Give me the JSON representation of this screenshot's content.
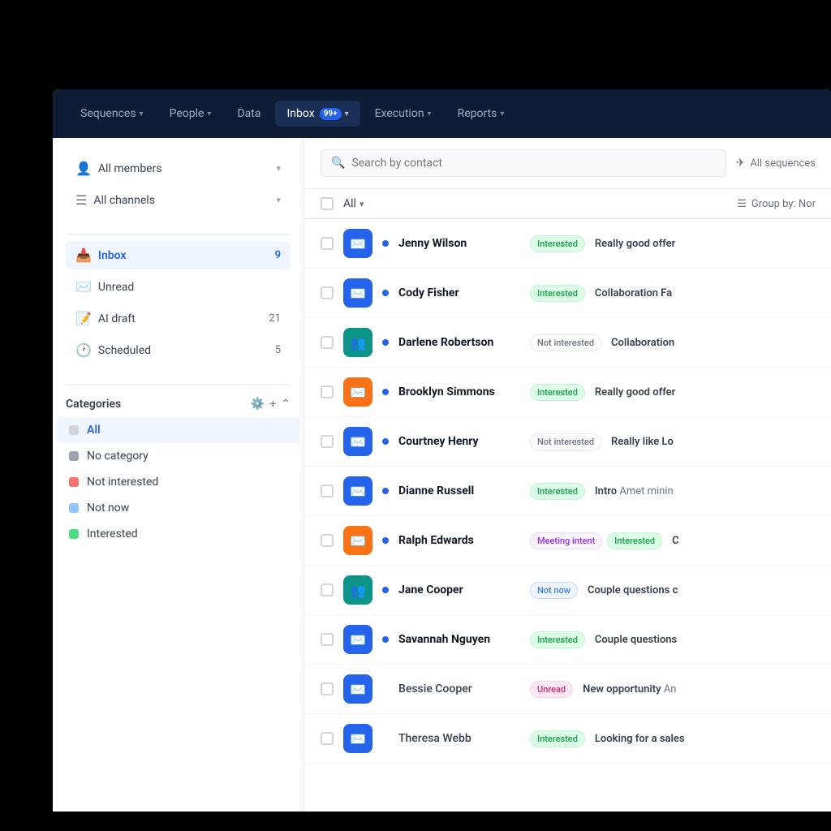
{
  "nav": {
    "items": [
      {
        "id": "sequences",
        "label": "Sequences",
        "hasChevron": true,
        "active": false,
        "badge": null
      },
      {
        "id": "people",
        "label": "People",
        "hasChevron": true,
        "active": false,
        "badge": null
      },
      {
        "id": "data",
        "label": "Data",
        "hasChevron": false,
        "active": false,
        "badge": null
      },
      {
        "id": "inbox",
        "label": "Inbox",
        "hasChevron": true,
        "active": true,
        "badge": "99+"
      },
      {
        "id": "execution",
        "label": "Execution",
        "hasChevron": true,
        "active": false,
        "badge": null
      },
      {
        "id": "reports",
        "label": "Reports",
        "hasChevron": true,
        "active": false,
        "badge": null
      }
    ]
  },
  "sidebar": {
    "filters": [
      {
        "id": "all-members",
        "label": "All members",
        "icon": "👤",
        "count": null
      },
      {
        "id": "all-channels",
        "label": "All channels",
        "icon": "☰",
        "count": null
      }
    ],
    "items": [
      {
        "id": "inbox",
        "label": "Inbox",
        "icon": "📥",
        "count": "9",
        "active": true
      },
      {
        "id": "unread",
        "label": "Unread",
        "icon": "✉️",
        "count": null,
        "active": false
      },
      {
        "id": "ai-draft",
        "label": "AI draft",
        "icon": "📝",
        "count": "21",
        "active": false
      },
      {
        "id": "scheduled",
        "label": "Scheduled",
        "icon": "🕐",
        "count": "5",
        "active": false
      }
    ],
    "categories": {
      "title": "Categories",
      "items": [
        {
          "id": "all",
          "label": "All",
          "color": "#e5e7eb",
          "active": true
        },
        {
          "id": "no-category",
          "label": "No category",
          "color": "#9ca3af",
          "active": false
        },
        {
          "id": "not-interested",
          "label": "Not interested",
          "color": "#f87171",
          "active": false
        },
        {
          "id": "not-now",
          "label": "Not now",
          "color": "#93c5fd",
          "active": false
        },
        {
          "id": "interested",
          "label": "Interested",
          "color": "#4ade80",
          "active": false
        }
      ]
    }
  },
  "toolbar": {
    "search_placeholder": "Search by contact",
    "sequences_label": "All sequences",
    "all_label": "All",
    "group_label": "Group by: Nor"
  },
  "contacts": [
    {
      "id": 1,
      "name": "Jenny Wilson",
      "avatar_type": "blue",
      "avatar_icon": "✉️",
      "unread": true,
      "tags": [
        "Interested"
      ],
      "preview_bold": "Really good offer",
      "preview": ""
    },
    {
      "id": 2,
      "name": "Cody Fisher",
      "avatar_type": "blue",
      "avatar_icon": "✉️",
      "unread": true,
      "tags": [
        "Interested"
      ],
      "preview_bold": "Collaboration Fa",
      "preview": ""
    },
    {
      "id": 3,
      "name": "Darlene Robertson",
      "avatar_type": "teal",
      "avatar_icon": "👥",
      "unread": true,
      "tags": [
        "Not interested"
      ],
      "preview_bold": "Collaboration",
      "preview": ""
    },
    {
      "id": 4,
      "name": "Brooklyn Simmons",
      "avatar_type": "orange",
      "avatar_icon": "✉️",
      "unread": true,
      "tags": [
        "Interested"
      ],
      "preview_bold": "Really good offer",
      "preview": ""
    },
    {
      "id": 5,
      "name": "Courtney Henry",
      "avatar_type": "blue",
      "avatar_icon": "✉️",
      "unread": true,
      "tags": [
        "Not interested"
      ],
      "preview_bold": "Really like Lo",
      "preview": ""
    },
    {
      "id": 6,
      "name": "Dianne Russell",
      "avatar_type": "blue",
      "avatar_icon": "✉️",
      "unread": true,
      "tags": [
        "Interested"
      ],
      "preview_bold": "Intro",
      "preview": "Amet minin"
    },
    {
      "id": 7,
      "name": "Ralph Edwards",
      "avatar_type": "orange",
      "avatar_icon": "✉️",
      "unread": true,
      "tags": [
        "Meeting intent",
        "Interested"
      ],
      "preview_bold": "C",
      "preview": ""
    },
    {
      "id": 8,
      "name": "Jane Cooper",
      "avatar_type": "teal",
      "avatar_icon": "👥",
      "unread": true,
      "tags": [
        "Not now"
      ],
      "preview_bold": "Couple questions c",
      "preview": ""
    },
    {
      "id": 9,
      "name": "Savannah Nguyen",
      "avatar_type": "blue",
      "avatar_icon": "✉️",
      "unread": true,
      "tags": [
        "Interested"
      ],
      "preview_bold": "Couple questions",
      "preview": ""
    },
    {
      "id": 10,
      "name": "Bessie Cooper",
      "avatar_type": "blue",
      "avatar_icon": "✉️",
      "unread": false,
      "tags": [
        "Unread"
      ],
      "preview_bold": "New opportunity",
      "preview": "An"
    },
    {
      "id": 11,
      "name": "Theresa Webb",
      "avatar_type": "blue",
      "avatar_icon": "✉️",
      "unread": false,
      "tags": [
        "Interested"
      ],
      "preview_bold": "Looking for a sales",
      "preview": ""
    }
  ]
}
